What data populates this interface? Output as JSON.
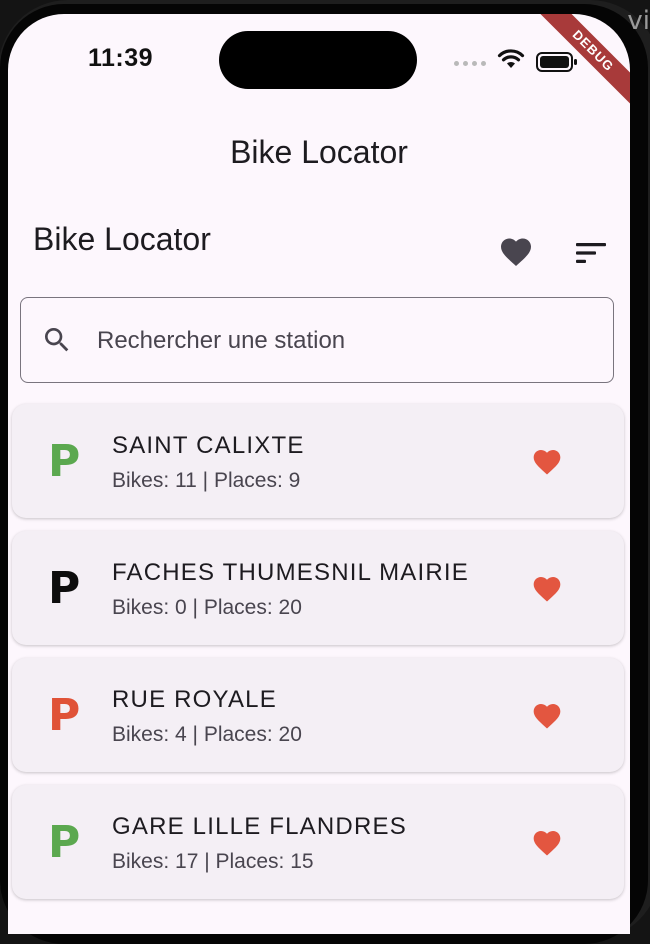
{
  "status_bar": {
    "time": "11:39",
    "debug_label": "DEBUG"
  },
  "corner_glyph": "vi",
  "app_bar": {
    "title": "Bike Locator"
  },
  "header": {
    "title": "Bike Locator",
    "favorites_icon": "heart-icon",
    "sort_icon": "sort-icon"
  },
  "search": {
    "placeholder": "Rechercher une station",
    "value": ""
  },
  "colors": {
    "available": "#5ba84f",
    "empty": "#0d0d0d",
    "low": "#e05237",
    "favorite": "#e35640"
  },
  "stations": [
    {
      "name": "SAINT CALIXTE",
      "stats": "Bikes: 11 | Places: 9",
      "status_color": "#5ba84f",
      "icon": "P"
    },
    {
      "name": "FACHES THUMESNIL MAIRIE",
      "stats": "Bikes: 0 | Places: 20",
      "status_color": "#0d0d0d",
      "icon": "P"
    },
    {
      "name": "RUE ROYALE",
      "stats": "Bikes: 4 | Places: 20",
      "status_color": "#e05237",
      "icon": "P"
    },
    {
      "name": "GARE LILLE FLANDRES",
      "stats": "Bikes: 17 | Places: 15",
      "status_color": "#5ba84f",
      "icon": "P"
    }
  ]
}
